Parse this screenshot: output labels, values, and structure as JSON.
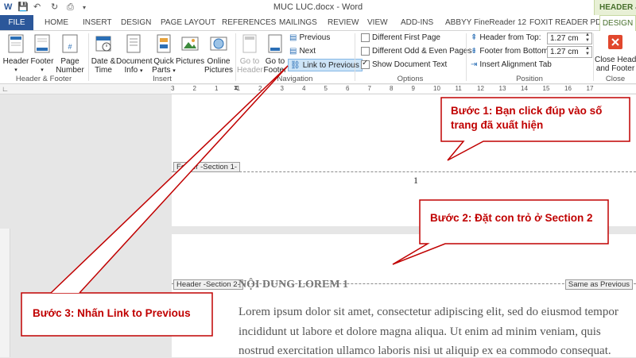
{
  "window": {
    "title": "MUC LUC.docx - Word",
    "context_tab_group": "HEADER &",
    "qat": {
      "word_icon": "W",
      "save": "💾",
      "undo": "↶",
      "redo": "↻",
      "print": "⎙"
    }
  },
  "tabs": [
    {
      "label": "FILE"
    },
    {
      "label": "HOME"
    },
    {
      "label": "INSERT"
    },
    {
      "label": "DESIGN"
    },
    {
      "label": "PAGE LAYOUT"
    },
    {
      "label": "REFERENCES"
    },
    {
      "label": "MAILINGS"
    },
    {
      "label": "REVIEW"
    },
    {
      "label": "VIEW"
    },
    {
      "label": "ADD-INS"
    },
    {
      "label": "ABBYY FineReader 12"
    },
    {
      "label": "FOXIT READER PDF"
    },
    {
      "label": "DESIGN"
    }
  ],
  "ribbon": {
    "header": "Header",
    "footer": "Footer",
    "page_number_1": "Page",
    "page_number_2": "Number",
    "date_time_1": "Date &",
    "date_time_2": "Time",
    "doc_info_1": "Document",
    "doc_info_2": "Info",
    "quick_parts_1": "Quick",
    "quick_parts_2": "Parts",
    "pictures": "Pictures",
    "online_pictures_1": "Online",
    "online_pictures_2": "Pictures",
    "goto_header_1": "Go to",
    "goto_header_2": "Header",
    "goto_footer_1": "Go to",
    "goto_footer_2": "Footer",
    "previous": "Previous",
    "next": "Next",
    "link_to_previous": "Link to Previous",
    "different_first_page": "Different First Page",
    "different_odd_even": "Different Odd & Even Pages",
    "show_document_text": "Show Document Text",
    "header_from_top": "Header from Top:",
    "header_from_top_value": "1.27 cm",
    "footer_from_bottom": "Footer from Bottom:",
    "footer_from_bottom_value": "1.27 cm",
    "insert_alignment_tab": "Insert Alignment Tab",
    "close_1": "Close Header",
    "close_2": "and Footer",
    "groups": {
      "header_footer": "Header & Footer",
      "insert": "Insert",
      "navigation": "Navigation",
      "options": "Options",
      "position": "Position",
      "close": "Close"
    },
    "options_checked": {
      "different_first_page": false,
      "different_odd_even": false,
      "show_document_text": true
    }
  },
  "ruler": {
    "numbers": [
      "3",
      "2",
      "1",
      "1",
      "2",
      "3",
      "4",
      "5",
      "6",
      "7",
      "8",
      "9",
      "10",
      "11",
      "12",
      "13",
      "14",
      "15",
      "16",
      "17"
    ]
  },
  "document": {
    "footer_section_tag": "Footer -Section 1-",
    "page_number": "1",
    "header_section_tag": "Header -Section 2-",
    "same_as_previous": "Same as Previous",
    "heading": "NỘI DUNG LOREM 1",
    "paragraph_lines": [
      "Lorem ipsum dolor sit amet, consectetur adipiscing elit, sed do eiusmod tempor",
      "incididunt ut labore et dolore magna aliqua. Ut enim ad minim veniam, quis",
      "nostrud exercitation ullamco laboris nisi ut aliquip ex ea commodo consequat."
    ]
  },
  "callouts": {
    "step1_line1": "Bước 1: Bạn click đúp vào số",
    "step1_line2": "trang đã xuất hiện",
    "step2": "Bước 2: Đặt con trỏ ở Section 2",
    "step3": "Bước 3: Nhấn Link to Previous"
  },
  "colors": {
    "file_tab": "#2b579a",
    "context_tab": "#48702d",
    "callout": "#c00000",
    "close_icon": "#e1472d"
  }
}
